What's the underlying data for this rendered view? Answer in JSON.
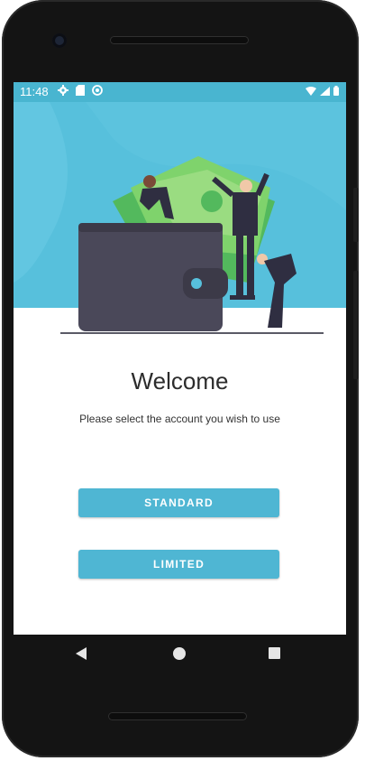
{
  "status_bar": {
    "time": "11:48",
    "left_icons": [
      "settings-icon",
      "sd-card-icon",
      "sync-icon"
    ],
    "right_icons": [
      "wifi-icon",
      "signal-icon",
      "battery-icon"
    ],
    "color": "#49b5d0"
  },
  "welcome": {
    "title": "Welcome",
    "subtitle": "Please select the account you wish to use"
  },
  "buttons": {
    "standard_label": "STANDARD",
    "limited_label": "LIMITED",
    "color": "#4fb6d3"
  },
  "nav": {
    "icons": [
      "back-icon",
      "home-icon",
      "recents-icon"
    ]
  }
}
